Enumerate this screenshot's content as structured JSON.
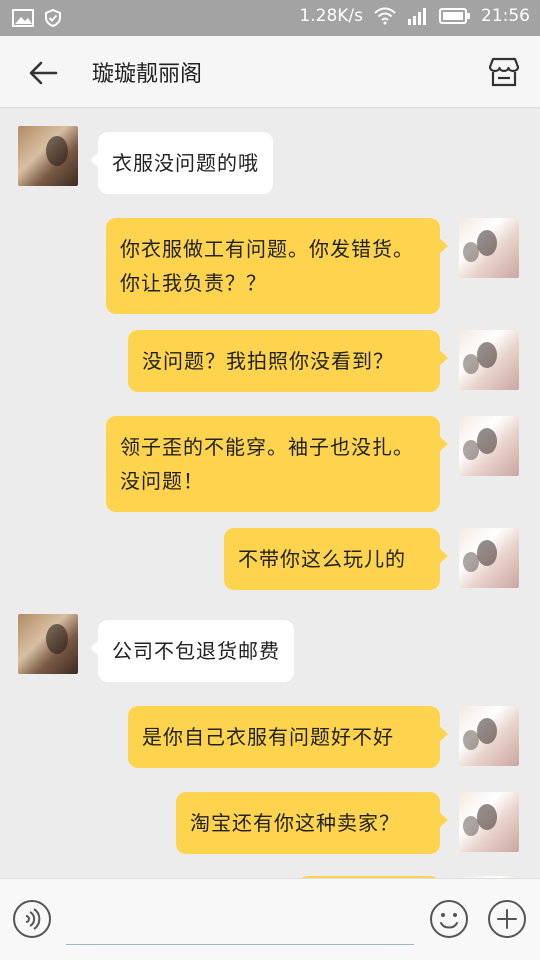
{
  "status": {
    "speed": "1.28K/s",
    "time": "21:56"
  },
  "header": {
    "title": "璇璇靓丽阁"
  },
  "messages": [
    {
      "side": "in",
      "text": "衣服没问题的哦"
    },
    {
      "side": "out",
      "text": "你衣服做工有问题。你发错货。你让我负责？？"
    },
    {
      "side": "out",
      "text": "没问题？我拍照你没看到？"
    },
    {
      "side": "out",
      "text": "领子歪的不能穿。袖子也没扎。没问题！"
    },
    {
      "side": "out",
      "text": "不带你这么玩儿的"
    },
    {
      "side": "in",
      "text": "公司不包退货邮费"
    },
    {
      "side": "out",
      "text": "是你自己衣服有问题好不好"
    },
    {
      "side": "out",
      "text": "淘宝还有你这种卖家？"
    }
  ],
  "input": {
    "placeholder": ""
  },
  "colors": {
    "statusbar": "#a3a3a3",
    "outgoing_bubble": "#fed44e",
    "incoming_bubble": "#ffffff",
    "background": "#ececec"
  },
  "icons": [
    "gallery-icon",
    "shield-icon",
    "wifi-icon",
    "signal-icon",
    "battery-icon",
    "back-arrow-icon",
    "shop-icon",
    "voice-icon",
    "emoji-icon",
    "plus-icon"
  ]
}
